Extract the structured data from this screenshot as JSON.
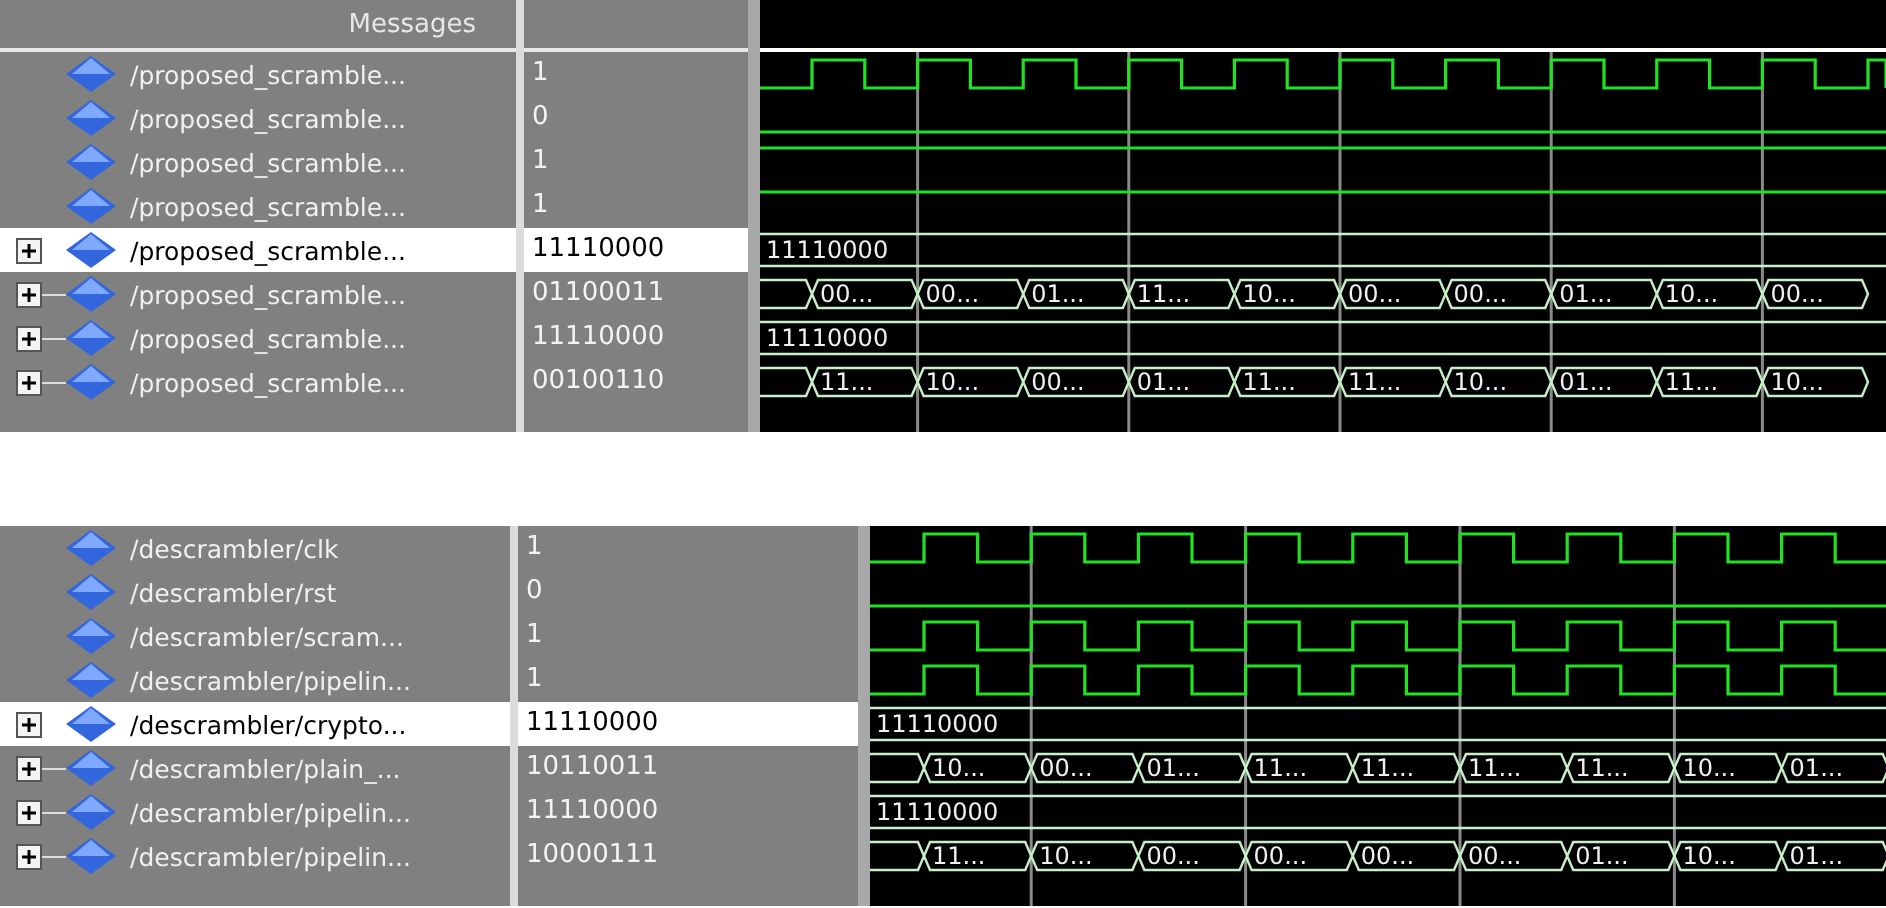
{
  "panels": [
    {
      "header": "Messages",
      "signals": [
        {
          "name": "/proposed_scramble...",
          "value": "1",
          "kind": "clock",
          "selected": false
        },
        {
          "name": "/proposed_scramble...",
          "value": "0",
          "kind": "low",
          "selected": false
        },
        {
          "name": "/proposed_scramble...",
          "value": "1",
          "kind": "high",
          "selected": false
        },
        {
          "name": "/proposed_scramble...",
          "value": "1",
          "kind": "high",
          "selected": false
        },
        {
          "name": "/proposed_scramble...",
          "value": "11110000",
          "kind": "bus",
          "selected": true,
          "labels": [
            "11110000"
          ]
        },
        {
          "name": "/proposed_scramble...",
          "value": "01100011",
          "kind": "bus",
          "selected": false,
          "labels": [
            "00...",
            "00...",
            "01...",
            "11...",
            "10...",
            "00...",
            "00...",
            "01...",
            "10...",
            "00..."
          ]
        },
        {
          "name": "/proposed_scramble...",
          "value": "11110000",
          "kind": "bus",
          "selected": false,
          "labels": [
            "11110000"
          ]
        },
        {
          "name": "/proposed_scramble...",
          "value": "00100110",
          "kind": "bus",
          "selected": false,
          "labels": [
            "11...",
            "10...",
            "00...",
            "01...",
            "11...",
            "11...",
            "10...",
            "01...",
            "11...",
            "10..."
          ]
        }
      ]
    },
    {
      "signals": [
        {
          "name": "/descrambler/clk",
          "value": "1",
          "kind": "clock",
          "selected": false
        },
        {
          "name": "/descrambler/rst",
          "value": "0",
          "kind": "low",
          "selected": false
        },
        {
          "name": "/descrambler/scram...",
          "value": "1",
          "kind": "clock",
          "selected": false
        },
        {
          "name": "/descrambler/pipelin...",
          "value": "1",
          "kind": "clock",
          "selected": false
        },
        {
          "name": "/descrambler/crypto...",
          "value": "11110000",
          "kind": "bus",
          "selected": true,
          "labels": [
            "11110000"
          ]
        },
        {
          "name": "/descrambler/plain_...",
          "value": "10110011",
          "kind": "bus",
          "selected": false,
          "labels": [
            "10...",
            "00...",
            "01...",
            "11...",
            "11...",
            "11...",
            "11...",
            "10...",
            "01..."
          ]
        },
        {
          "name": "/descrambler/pipelin...",
          "value": "11110000",
          "kind": "bus",
          "selected": false,
          "labels": [
            "11110000"
          ]
        },
        {
          "name": "/descrambler/pipelin...",
          "value": "10000111",
          "kind": "bus",
          "selected": false,
          "labels": [
            "11...",
            "10...",
            "00...",
            "00...",
            "00...",
            "00...",
            "01...",
            "10...",
            "01..."
          ]
        }
      ]
    }
  ]
}
